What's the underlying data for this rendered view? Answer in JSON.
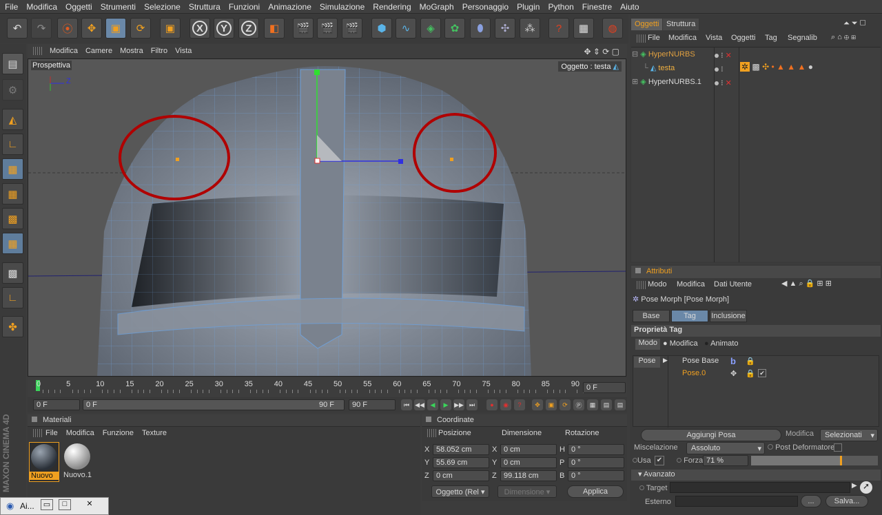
{
  "menu": [
    "File",
    "Modifica",
    "Oggetti",
    "Strumenti",
    "Selezione",
    "Struttura",
    "Funzioni",
    "Animazione",
    "Simulazione",
    "Rendering",
    "MoGraph",
    "Personaggio",
    "Plugin",
    "Python",
    "Finestre",
    "Aiuto"
  ],
  "toolbar_icons": [
    "undo-icon",
    "redo-icon",
    "select-icon",
    "move-icon",
    "scale-icon",
    "rotate-icon",
    "last-tool-icon",
    "x-axis-icon",
    "y-axis-icon",
    "z-axis-icon",
    "coordinate-system-icon",
    "render-view-icon",
    "render-picture-icon",
    "render-settings-icon",
    "cube-icon",
    "spline-icon",
    "nurbs-icon",
    "array-icon",
    "deformer-icon",
    "scene-icon",
    "environment-icon",
    "help-icon",
    "render-queue-icon",
    "web-icon"
  ],
  "axes": {
    "x": "X",
    "y": "Y",
    "z": "Z"
  },
  "viewport": {
    "menu": [
      "Modifica",
      "Camere",
      "Mostra",
      "Filtro",
      "Vista"
    ],
    "label": "Prospettiva",
    "object_label": "Oggetto : testa",
    "axis_z": "Z"
  },
  "timeline": {
    "ticks": [
      "0",
      "5",
      "10",
      "15",
      "20",
      "25",
      "30",
      "35",
      "40",
      "45",
      "50",
      "55",
      "60",
      "65",
      "70",
      "75",
      "80",
      "85",
      "90"
    ],
    "current_frame": "0 F",
    "start_field": "0 F",
    "range_start": "0 F",
    "range_end": "90 F",
    "end_field": "90 F"
  },
  "materials": {
    "title": "Materiali",
    "menu": [
      "File",
      "Modifica",
      "Funzione",
      "Texture"
    ],
    "items": [
      "Nuovo",
      "Nuovo.1"
    ]
  },
  "coordinates": {
    "title": "Coordinate",
    "col_position": "Posizione",
    "col_dimension": "Dimensione",
    "col_rotation": "Rotazione",
    "rows": [
      {
        "axis": "X",
        "pos": "58.052 cm",
        "daxis": "X",
        "dim": "0 cm",
        "raxis": "H",
        "rot": "0 °"
      },
      {
        "axis": "Y",
        "pos": "55.69 cm",
        "daxis": "Y",
        "dim": "0 cm",
        "raxis": "P",
        "rot": "0 °"
      },
      {
        "axis": "Z",
        "pos": "0 cm",
        "daxis": "Z",
        "dim": "99.118 cm",
        "raxis": "B",
        "rot": "0 °"
      }
    ],
    "mode": "Oggetto (Rel",
    "dim_mode": "Dimensione",
    "apply": "Applica"
  },
  "objects": {
    "tabs": [
      "Oggetti",
      "Struttura"
    ],
    "menu": [
      "File",
      "Modifica",
      "Vista",
      "Oggetti",
      "Tag",
      "Segnalib"
    ],
    "tree": [
      {
        "name": "HyperNURBS",
        "color": "#e0a040"
      },
      {
        "name": "testa",
        "color": "#f0b040"
      },
      {
        "name": "HyperNURBS.1",
        "color": "#d8d8d8"
      }
    ]
  },
  "attributes": {
    "title": "Attributi",
    "menu": [
      "Modo",
      "Modifica",
      "Dati Utente"
    ],
    "object": "Pose Morph [Pose Morph]",
    "tabs": [
      "Base",
      "Tag",
      "Inclusione"
    ],
    "section": "Proprietà Tag",
    "mode_label": "Modo",
    "mode_options": [
      "Modifica",
      "Animato"
    ],
    "pose_label": "Pose",
    "poses": [
      "Pose Base",
      "Pose.0"
    ],
    "add_pose": "Aggiungi Posa",
    "edit_label": "Modifica",
    "edit_value": "Selezionati",
    "blend_label": "Miscelazione",
    "blend_value": "Assoluto",
    "post_deformer": "Post Deformatore",
    "use_label": "Usa",
    "strength_label": "Forza",
    "strength_value": "71 %",
    "strength": 0.71,
    "advanced": "Avanzato",
    "target_label": "Target",
    "external_label": "Esterno",
    "dots": "...",
    "save": "Salva..."
  },
  "taskbar": {
    "app": "Ai..."
  },
  "brand": "MAXON CINEMA 4D",
  "colors": {
    "accent": "#f0a020",
    "highlight": "#6a88a8",
    "circle": "#b00000"
  }
}
